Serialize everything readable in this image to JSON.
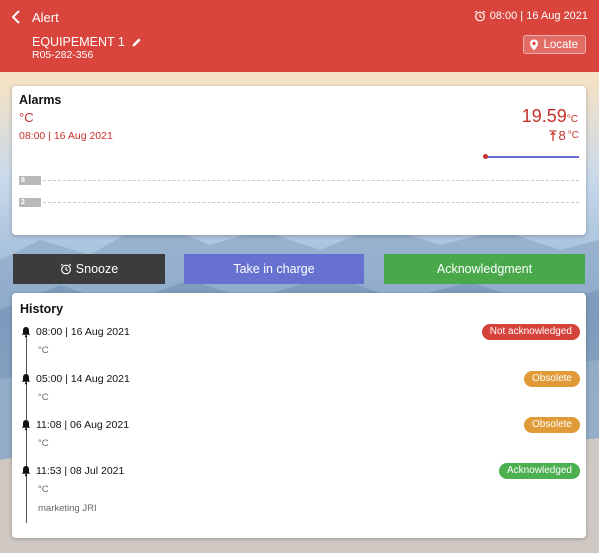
{
  "header": {
    "title": "Alert",
    "timestamp": "08:00 | 16 Aug 2021",
    "equipment_name": "EQUIPEMENT 1",
    "equipment_code": "R05-282-356",
    "locate_label": "Locate",
    "color": "#d9453d"
  },
  "alarms": {
    "title": "Alarms",
    "unit": "°C",
    "date": "08:00 | 16 Aug 2021",
    "value": "19.59",
    "value_unit": "°C",
    "threshold": "8",
    "threshold_unit": "°C",
    "level_high": "8",
    "level_low": "2"
  },
  "actions": {
    "snooze_label": "Snooze",
    "take_charge_label": "Take in charge",
    "acknowledgment_label": "Acknowledgment"
  },
  "history": {
    "title": "History",
    "entries": [
      {
        "time": "08:00 | 16 Aug 2021",
        "unit": "°C",
        "status": "Not acknowledged",
        "status_color": "#d5433b"
      },
      {
        "time": "05:00 | 14 Aug 2021",
        "unit": "°C",
        "status": "Obsolete",
        "status_color": "#e09a38"
      },
      {
        "time": "11:08 | 06 Aug 2021",
        "unit": "°C",
        "status": "Obsolete",
        "status_color": "#e09a38"
      },
      {
        "time": "11:53 | 08 Jul 2021",
        "unit": "°C",
        "status": "Acknowledged",
        "status_color": "#4caf50",
        "user": "marketing JRI"
      }
    ]
  }
}
